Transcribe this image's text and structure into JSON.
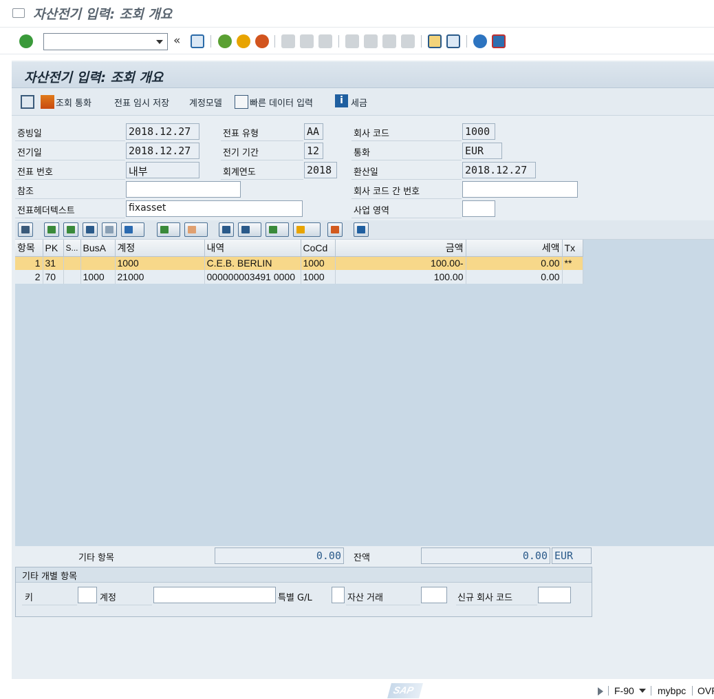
{
  "window": {
    "title": "자산전기 입력: 조회 개요"
  },
  "toolbar": {
    "command_value": "",
    "expand_label": "«"
  },
  "app": {
    "title": "자산전기 입력: 조회 개요",
    "bar": {
      "display_currency": "조회 통화",
      "park_document": "전표 임시 저장",
      "account_model": "계정모델",
      "fast_data_entry": "빠른 데이터 입력",
      "taxes": "세금"
    }
  },
  "header": {
    "document_date": {
      "label": "증빙일",
      "value": "2018.12.27"
    },
    "posting_date": {
      "label": "전기일",
      "value": "2018.12.27"
    },
    "document_number": {
      "label": "전표 번호",
      "value": "내부"
    },
    "reference": {
      "label": "참조",
      "value": ""
    },
    "header_text": {
      "label": "전표헤더텍스트",
      "value": "fixasset"
    },
    "document_type": {
      "label": "전표 유형",
      "value": "AA"
    },
    "period": {
      "label": "전기 기간",
      "value": "12"
    },
    "fiscal_year": {
      "label": "회계연도",
      "value": "2018"
    },
    "company_code": {
      "label": "회사 코드",
      "value": "1000"
    },
    "currency": {
      "label": "통화",
      "value": "EUR"
    },
    "translation_date": {
      "label": "환산일",
      "value": "2018.12.27"
    },
    "cross_cc_number": {
      "label": "회사 코드 간 번호",
      "value": ""
    },
    "business_area": {
      "label": "사업 영역",
      "value": ""
    }
  },
  "grid": {
    "columns": [
      "항목",
      "PK",
      "S...",
      "BusA",
      "계정",
      "내역",
      "CoCd",
      "금액",
      "세액",
      "Tx"
    ],
    "rows": [
      {
        "item": "1",
        "pk": "31",
        "s": "",
        "busa": "",
        "account": "1000",
        "text": "C.E.B. BERLIN",
        "cocd": "1000",
        "amount": "100.00-",
        "tax": "0.00",
        "tx": "**"
      },
      {
        "item": "2",
        "pk": "70",
        "s": "",
        "busa": "1000",
        "account": "21000",
        "text": "000000003491 0000",
        "cocd": "1000",
        "amount": "100.00",
        "tax": "0.00",
        "tx": ""
      }
    ]
  },
  "totals": {
    "other_items_label": "기타 항목",
    "other_items_value": "0.00",
    "balance_label": "잔액",
    "balance_value": "0.00",
    "balance_currency": "EUR"
  },
  "line_item_group": {
    "title": "기타 개별 항목",
    "key_label": "키",
    "key_value": "",
    "account_label": "계정",
    "account_value": "",
    "special_gl_label": "특별 G/L",
    "special_gl_value": "",
    "asset_txn_label": "자산 거래",
    "asset_txn_value": "",
    "new_cc_label": "신규 회사 코드",
    "new_cc_value": ""
  },
  "status": {
    "brand": "SAP",
    "transaction": "F-90",
    "system": "mybpc",
    "mode": "OVR"
  },
  "colors": {
    "accent": "#e8a400",
    "selected_row": "#f7d88a",
    "grid_bg": "#c9d9e6"
  }
}
